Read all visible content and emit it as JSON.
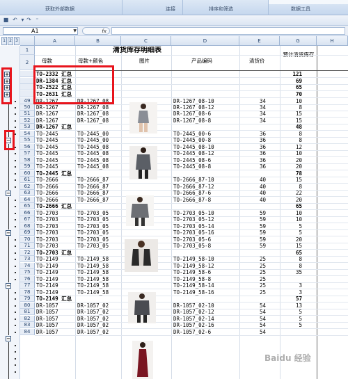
{
  "ribbon": {
    "groups": [
      "获取外部数据",
      "连接",
      "排序和筛选",
      "数据工具"
    ]
  },
  "formula_bar": {
    "name_box": "A1",
    "fx": "fx",
    "content": ""
  },
  "outline_levels": [
    "1",
    "2",
    "3"
  ],
  "columns": [
    "A",
    "B",
    "C",
    "D",
    "E",
    "G",
    "H"
  ],
  "sheet": {
    "title": "清货库存明细表",
    "headers": {
      "a": "母款",
      "b": "母款+颜色",
      "c": "图片",
      "d": "产品编码",
      "e": "清货价",
      "g": "预计清货库存"
    },
    "rows": [
      {
        "n": "1",
        "a": "",
        "b": "",
        "d": "",
        "e": "",
        "g": ""
      },
      {
        "n": "2",
        "a": "",
        "b": "",
        "d": "",
        "e": "",
        "g": ""
      },
      {
        "n": "",
        "a": "TO-2332 汇总",
        "b": "",
        "d": "",
        "e": "",
        "g": "121",
        "bold": true
      },
      {
        "n": "",
        "a": "DR-1384 汇总",
        "b": "",
        "d": "",
        "e": "",
        "g": "69",
        "bold": true
      },
      {
        "n": "",
        "a": "TO-2522 汇总",
        "b": "",
        "d": "",
        "e": "",
        "g": "65",
        "bold": true
      },
      {
        "n": "",
        "a": "TO-2631 汇总",
        "b": "",
        "d": "",
        "e": "",
        "g": "70",
        "bold": true
      },
      {
        "n": "49",
        "a": "DR-1267",
        "b": "DR-1267_08",
        "d": "DR-1267_08-10",
        "e": "34",
        "g": "10"
      },
      {
        "n": "50",
        "a": "DR-1267",
        "b": "DR-1267_08",
        "d": "DR-1267_08-12",
        "e": "34",
        "g": "8"
      },
      {
        "n": "51",
        "a": "DR-1267",
        "b": "DR-1267_08",
        "d": "DR-1267_08-6",
        "e": "34",
        "g": "15"
      },
      {
        "n": "52",
        "a": "DR-1267",
        "b": "DR-1267_08",
        "d": "DR-1267_08-8",
        "e": "34",
        "g": "15"
      },
      {
        "n": "53",
        "a": "DR-1267 汇总",
        "b": "",
        "d": "",
        "e": "",
        "g": "48",
        "bold": true
      },
      {
        "n": "54",
        "a": "TO-2445",
        "b": "TO-2445_00",
        "d": "TO-2445_00-6",
        "e": "36",
        "g": "8"
      },
      {
        "n": "55",
        "a": "TO-2445",
        "b": "TO-2445_00",
        "d": "TO-2445_00-8",
        "e": "36",
        "g": "8"
      },
      {
        "n": "56",
        "a": "TO-2445",
        "b": "TO-2445_08",
        "d": "TO-2445_08-10",
        "e": "36",
        "g": "12"
      },
      {
        "n": "57",
        "a": "TO-2445",
        "b": "TO-2445_08",
        "d": "TO-2445_08-12",
        "e": "36",
        "g": "10"
      },
      {
        "n": "58",
        "a": "TO-2445",
        "b": "TO-2445_08",
        "d": "TO-2445_08-6",
        "e": "36",
        "g": "20"
      },
      {
        "n": "59",
        "a": "TO-2445",
        "b": "TO-2445_08",
        "d": "TO-2445_08-8",
        "e": "36",
        "g": "20"
      },
      {
        "n": "60",
        "a": "TO-2445 汇总",
        "b": "",
        "d": "",
        "e": "",
        "g": "78",
        "bold": true
      },
      {
        "n": "61",
        "a": "TO-2666",
        "b": "TO-2666_87",
        "d": "TO-2666_87-10",
        "e": "40",
        "g": "15"
      },
      {
        "n": "62",
        "a": "TO-2666",
        "b": "TO-2666_87",
        "d": "TO-2666_87-12",
        "e": "40",
        "g": "8"
      },
      {
        "n": "63",
        "a": "TO-2666",
        "b": "TO-2666_87",
        "d": "TO-2666_87-6",
        "e": "40",
        "g": "22"
      },
      {
        "n": "64",
        "a": "TO-2666",
        "b": "TO-2666_87",
        "d": "TO-2666_87-8",
        "e": "40",
        "g": "20"
      },
      {
        "n": "65",
        "a": "TO-2666 汇总",
        "b": "",
        "d": "",
        "e": "",
        "g": "65",
        "bold": true
      },
      {
        "n": "66",
        "a": "TO-2703",
        "b": "TO-2703_05",
        "d": "TO-2703_05-10",
        "e": "59",
        "g": "10"
      },
      {
        "n": "67",
        "a": "TO-2703",
        "b": "TO-2703_05",
        "d": "TO-2703_05-12",
        "e": "59",
        "g": "10"
      },
      {
        "n": "68",
        "a": "TO-2703",
        "b": "TO-2703_05",
        "d": "TO-2703_05-14",
        "e": "59",
        "g": "5"
      },
      {
        "n": "69",
        "a": "TO-2703",
        "b": "TO-2703_05",
        "d": "TO-2703_05-16",
        "e": "59",
        "g": "5"
      },
      {
        "n": "70",
        "a": "TO-2703",
        "b": "TO-2703_05",
        "d": "TO-2703_05-6",
        "e": "59",
        "g": "20"
      },
      {
        "n": "71",
        "a": "TO-2703",
        "b": "TO-2703_05",
        "d": "TO-2703_05-8",
        "e": "59",
        "g": "15"
      },
      {
        "n": "72",
        "a": "TO-2703 汇总",
        "b": "",
        "d": "",
        "e": "",
        "g": "65",
        "bold": true
      },
      {
        "n": "73",
        "a": "TO-2149",
        "b": "TO-2149_58",
        "d": "TO-2149_58-10",
        "e": "25",
        "g": "8"
      },
      {
        "n": "74",
        "a": "TO-2149",
        "b": "TO-2149_58",
        "d": "TO-2149_58-12",
        "e": "25",
        "g": "8"
      },
      {
        "n": "75",
        "a": "TO-2149",
        "b": "TO-2149_58",
        "d": "TO-2149_58-6",
        "e": "25",
        "g": "35"
      },
      {
        "n": "76",
        "a": "TO-2149",
        "b": "TO-2149_58",
        "d": "TO-2149_58-8",
        "e": "25",
        "g": ""
      },
      {
        "n": "77",
        "a": "TO-2149",
        "b": "TO-2149_58",
        "d": "TO-2149_58-14",
        "e": "25",
        "g": "3"
      },
      {
        "n": "78",
        "a": "TO-2149",
        "b": "TO-2149_58",
        "d": "TO-2149_58-16",
        "e": "25",
        "g": "3"
      },
      {
        "n": "79",
        "a": "TO-2149 汇总",
        "b": "",
        "d": "",
        "e": "",
        "g": "57",
        "bold": true
      },
      {
        "n": "80",
        "a": "DR-1057",
        "b": "DR-1057_02",
        "d": "DR-1057_02-10",
        "e": "54",
        "g": "13"
      },
      {
        "n": "81",
        "a": "DR-1057",
        "b": "DR-1057_02",
        "d": "DR-1057_02-12",
        "e": "54",
        "g": "5"
      },
      {
        "n": "82",
        "a": "DR-1057",
        "b": "DR-1057_02",
        "d": "DR-1057_02-14",
        "e": "54",
        "g": "5"
      },
      {
        "n": "83",
        "a": "DR-1057",
        "b": "DR-1057_02",
        "d": "DR-1057_02-16",
        "e": "54",
        "g": "5"
      },
      {
        "n": "84",
        "a": "DR-1057",
        "b": "DR-1057_02",
        "d": "DR-1057_02-6",
        "e": "54",
        "g": ""
      }
    ]
  },
  "watermark": "Baidu 经验"
}
